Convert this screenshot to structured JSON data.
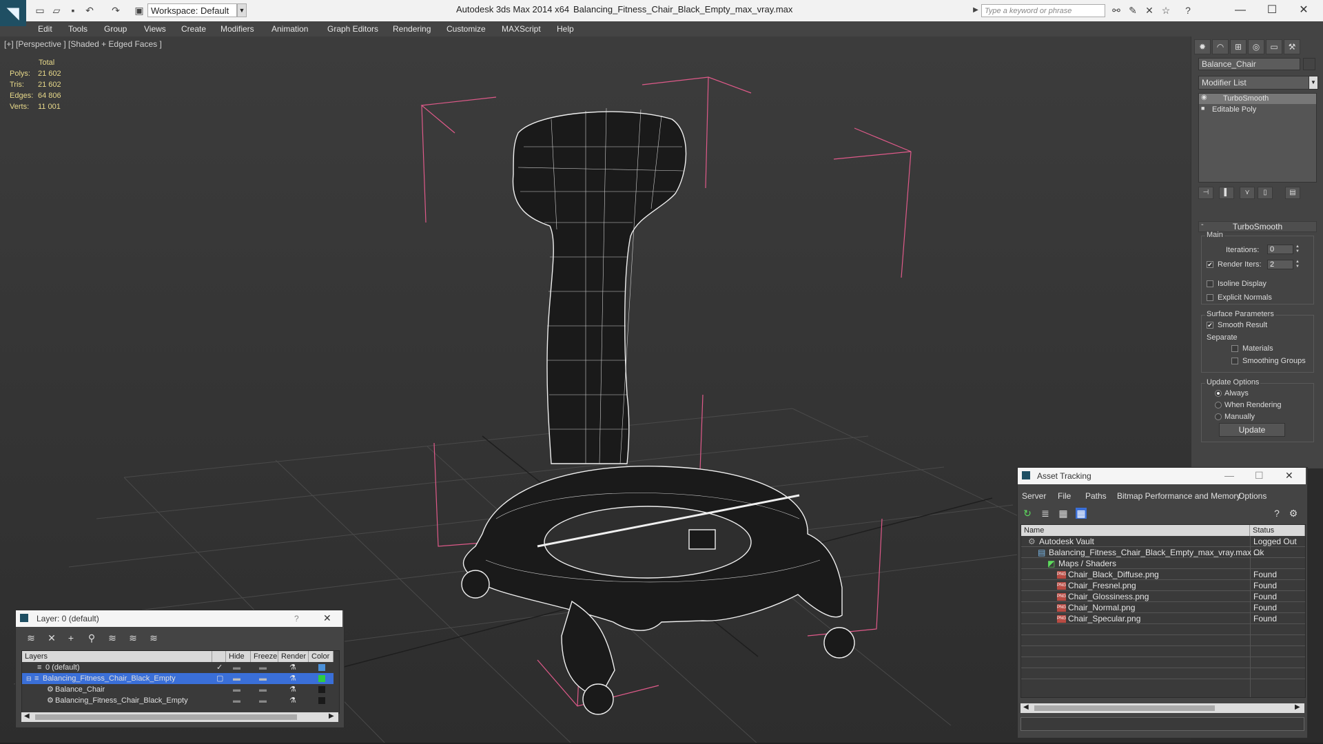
{
  "titlebar": {
    "workspace": "Workspace: Default",
    "app_title": "Autodesk 3ds Max  2014 x64",
    "file_title": "Balancing_Fitness_Chair_Black_Empty_max_vray.max",
    "search_placeholder": "Type a keyword or phrase"
  },
  "menu": [
    "Edit",
    "Tools",
    "Group",
    "Views",
    "Create",
    "Modifiers",
    "Animation",
    "Graph Editors",
    "Rendering",
    "Customize",
    "MAXScript",
    "Help"
  ],
  "viewport": {
    "label": "[+] [Perspective ] [Shaded + Edged Faces ]",
    "stats": {
      "header": "Total",
      "rows": [
        {
          "label": "Polys:",
          "value": "21 602"
        },
        {
          "label": "Tris:",
          "value": "21 602"
        },
        {
          "label": "Edges:",
          "value": "64 806"
        },
        {
          "label": "Verts:",
          "value": "11 001"
        }
      ]
    }
  },
  "command_panel": {
    "object_name": "Balance_Chair",
    "modifier_list": "Modifier List",
    "stack": [
      "TurboSmooth",
      "Editable Poly"
    ],
    "rollout_title": "TurboSmooth",
    "main_group": "Main",
    "iterations_label": "Iterations:",
    "iterations_value": "0",
    "render_iters_label": "Render Iters:",
    "render_iters_value": "2",
    "isoline_display": "Isoline Display",
    "explicit_normals": "Explicit Normals",
    "surface_params": "Surface Parameters",
    "smooth_result": "Smooth Result",
    "separate": "Separate",
    "materials": "Materials",
    "smoothing_groups": "Smoothing Groups",
    "update_options": "Update Options",
    "always": "Always",
    "when_rendering": "When Rendering",
    "manually": "Manually",
    "update_button": "Update"
  },
  "layer_dialog": {
    "title": "Layer: 0 (default)",
    "help": "?",
    "columns": [
      "Layers",
      "Hide",
      "Freeze",
      "Render",
      "Color"
    ],
    "rows": [
      {
        "name": "0 (default)",
        "color": "#4a90d9"
      },
      {
        "name": "Balancing_Fitness_Chair_Black_Empty",
        "color": "#2ecc40"
      },
      {
        "name": "Balance_Chair",
        "color": "#1a1a1a"
      },
      {
        "name": "Balancing_Fitness_Chair_Black_Empty",
        "color": "#1a1a1a"
      }
    ]
  },
  "asset_dialog": {
    "title": "Asset Tracking",
    "menu": [
      "Server",
      "File",
      "Paths",
      "Bitmap Performance and Memory",
      "Options"
    ],
    "columns": [
      "Name",
      "Status"
    ],
    "rows": [
      {
        "name": "Autodesk Vault",
        "status": "Logged Out ..."
      },
      {
        "name": "Balancing_Fitness_Chair_Black_Empty_max_vray.max",
        "status": "Ok"
      },
      {
        "name": "Maps / Shaders",
        "status": ""
      },
      {
        "name": "Chair_Black_Diffuse.png",
        "status": "Found"
      },
      {
        "name": "Chair_Fresnel.png",
        "status": "Found"
      },
      {
        "name": "Chair_Glossiness.png",
        "status": "Found"
      },
      {
        "name": "Chair_Normal.png",
        "status": "Found"
      },
      {
        "name": "Chair_Specular.png",
        "status": "Found"
      }
    ]
  },
  "colors": {
    "selection_blue": "#3a6fd8",
    "stat_yellow": "#e8d98a",
    "bbox_pink": "#e05a8a"
  }
}
